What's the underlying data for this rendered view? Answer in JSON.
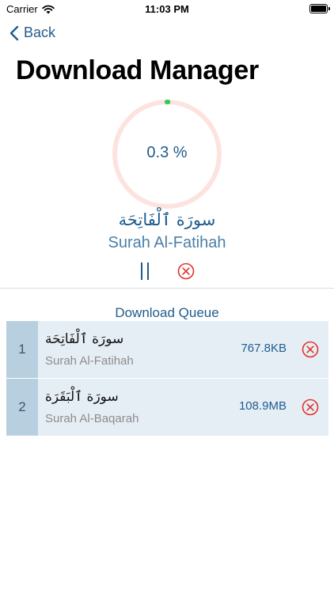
{
  "status_bar": {
    "carrier": "Carrier",
    "time": "11:03 PM",
    "wifi_icon": "wifi-icon",
    "battery_icon": "battery-icon"
  },
  "nav": {
    "back_label": "Back",
    "back_icon": "chevron-left-icon"
  },
  "page": {
    "title": "Download Manager"
  },
  "current_download": {
    "progress_label": "0.3 %",
    "progress_fraction": 0.003,
    "arabic_name": "سورَة ٱلْفَاتِحَة",
    "english_name": "Surah Al-Fatihah",
    "pause_icon": "pause-icon",
    "cancel_icon": "cancel-icon"
  },
  "queue": {
    "title": "Download Queue",
    "items": [
      {
        "index": "1",
        "arabic_name": "سورَة ٱلْفَاتِحَة",
        "english_name": "Surah Al-Fatihah",
        "size": "767.8KB"
      },
      {
        "index": "2",
        "arabic_name": "سورَة ٱلْبَقَرَة",
        "english_name": "Surah Al-Baqarah",
        "size": "108.9MB"
      }
    ]
  },
  "colors": {
    "accent": "#1f5c8e",
    "cancel_red": "#e0332b",
    "ring_track": "#fde3e0",
    "ring_progress": "#34c759",
    "queue_row_bg": "#e6eef5",
    "queue_index_bg": "#b8cfe0"
  }
}
